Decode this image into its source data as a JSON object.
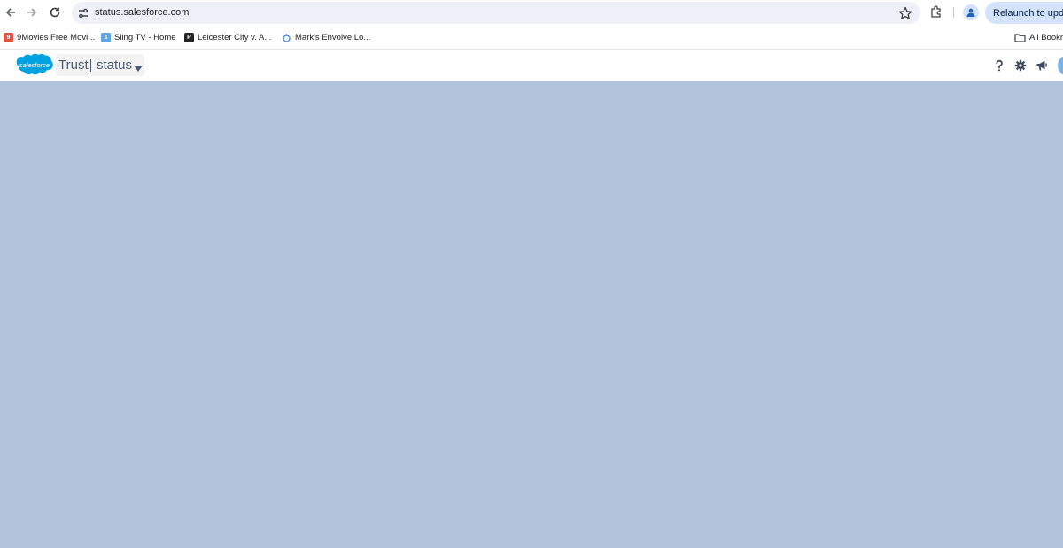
{
  "browser": {
    "url": "status.salesforce.com",
    "relaunch_label": "Relaunch to updat",
    "icons": [
      "back-arrow-icon",
      "forward-arrow-icon",
      "reload-icon",
      "site-settings-icon",
      "star-icon",
      "extensions-icon",
      "profile-icon"
    ]
  },
  "bookmarks": {
    "items": [
      {
        "label": "9Movies Free Movi...",
        "icon": "9movies-favicon",
        "color": "#e0533d"
      },
      {
        "label": "Sling TV - Home",
        "icon": "sling-favicon",
        "color": "#5aa6e6"
      },
      {
        "label": "Leicester City v. A...",
        "icon": "p-favicon",
        "color": "#222222"
      },
      {
        "label": "Mark's Envolve Lo...",
        "icon": "envolve-favicon",
        "color": "#4c8bd6"
      }
    ],
    "all_bookmarks_label": "All Bookm"
  },
  "site_header": {
    "logo_text": "salesforce",
    "switcher_trust": "Trust",
    "switcher_status": "status",
    "icons": [
      "help-icon",
      "settings-icon",
      "announcement-icon",
      "avatar"
    ],
    "brand_color": "#00a1e0"
  },
  "content": {
    "background_color": "#b3c3dc"
  }
}
